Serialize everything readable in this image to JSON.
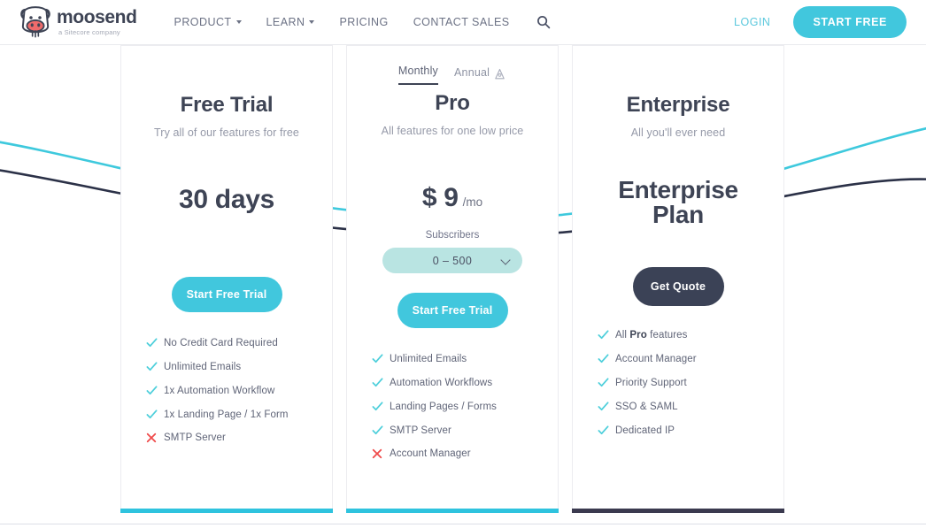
{
  "header": {
    "logo": {
      "icon": "cow-logo-icon",
      "word": "moosend",
      "tagline": "a Sitecore company"
    },
    "nav": [
      {
        "label": "PRODUCT",
        "has_dropdown": true
      },
      {
        "label": "LEARN",
        "has_dropdown": true
      },
      {
        "label": "PRICING",
        "has_dropdown": false
      },
      {
        "label": "CONTACT SALES",
        "has_dropdown": false
      }
    ],
    "search_icon": "search-icon",
    "login_label": "LOGIN",
    "start_free_label": "START FREE"
  },
  "billing_toggle": {
    "monthly_label": "Monthly",
    "annual_label": "Annual",
    "annual_icon": "piggy-bank-icon",
    "selected": "Monthly"
  },
  "plans": [
    {
      "id": "free-trial",
      "title": "Free Trial",
      "subtitle": "Try all of our features for free",
      "price": "30 days",
      "cta_label": "Start Free Trial",
      "cta_style": "teal",
      "accent_color": "#2fc3de",
      "features": [
        {
          "label": "No Credit Card Required",
          "included": true
        },
        {
          "label": "Unlimited Emails",
          "included": true
        },
        {
          "label": "1x Automation Workflow",
          "included": true
        },
        {
          "label": "1x Landing Page / 1x Form",
          "included": true
        },
        {
          "label": "SMTP Server",
          "included": false
        }
      ]
    },
    {
      "id": "pro",
      "title": "Pro",
      "subtitle": "All features for one low price",
      "price_amount": "$ 9",
      "price_period": "/mo",
      "subscribers_label": "Subscribers",
      "subscribers_value": "0 – 500",
      "cta_label": "Start Free Trial",
      "cta_style": "teal",
      "accent_color": "#2fc3de",
      "features": [
        {
          "label": "Unlimited Emails",
          "included": true
        },
        {
          "label": "Automation Workflows",
          "included": true
        },
        {
          "label": "Landing Pages / Forms",
          "included": true
        },
        {
          "label": "SMTP Server",
          "included": true
        },
        {
          "label": "Account Manager",
          "included": false
        }
      ]
    },
    {
      "id": "enterprise",
      "title": "Enterprise",
      "subtitle": "All you'll ever need",
      "price_line1": "Enterprise",
      "price_line2": "Plan",
      "cta_label": "Get Quote",
      "cta_style": "dark",
      "accent_color": "#3b3a4f",
      "features": [
        {
          "label_pre": "All ",
          "label_bold": "Pro",
          "label_post": " features",
          "included": true
        },
        {
          "label": "Account Manager",
          "included": true
        },
        {
          "label": "Priority Support",
          "included": true
        },
        {
          "label": "SSO & SAML",
          "included": true
        },
        {
          "label": "Dedicated IP",
          "included": true
        }
      ]
    }
  ],
  "colors": {
    "brand_teal": "#41c7dd",
    "accent_cyan": "#2fc3de",
    "dark_navy": "#3b4256",
    "check_green": "#4ecfdb",
    "cross_red": "#ef4b4b",
    "text_dark": "#3e4455",
    "text_muted": "#9599a8",
    "select_bg": "#b9e4e2"
  }
}
